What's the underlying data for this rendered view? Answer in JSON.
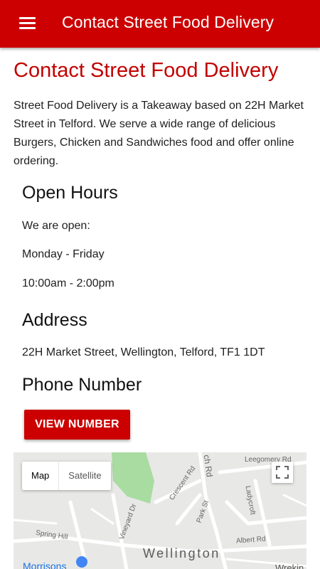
{
  "appbar": {
    "title": "Contact Street Food Delivery",
    "menu_icon": "hamburger-menu-icon"
  },
  "page": {
    "title": "Contact Street Food Delivery",
    "intro": "Street Food Delivery is a Takeaway based on 22H Market Street in Telford. We serve a wide range of delicious Burgers, Chicken and Sandwiches food and offer online ordering."
  },
  "open_hours": {
    "heading": "Open Hours",
    "lines": [
      "We are open:",
      "Monday - Friday",
      "10:00am - 2:00pm"
    ]
  },
  "address": {
    "heading": "Address",
    "text": "22H Market Street, Wellington, Telford, TF1 1DT"
  },
  "phone": {
    "heading": "Phone Number",
    "button_label": "VIEW NUMBER"
  },
  "map": {
    "type_options": [
      "Map",
      "Satellite"
    ],
    "selected_type": "Map",
    "labels": {
      "leegomery": "Leegomery Rd",
      "ch_rd": "ch Rd",
      "crescent": "Crescent Rd",
      "ladycroft": "Ladycroft",
      "park_st": "Park St",
      "vineyard": "Vineyard Dr",
      "spring_hill": "Spring Hill",
      "albert": "Albert Rd",
      "town": "Wellington",
      "poi": "Morrisons",
      "right_label": "Wrekin Co"
    },
    "colors": {
      "park": "#a8dca0",
      "road": "#ffffff",
      "background": "#e8e8e6"
    }
  },
  "colors": {
    "brand": "#cc0000",
    "title_red": "#c20000"
  }
}
